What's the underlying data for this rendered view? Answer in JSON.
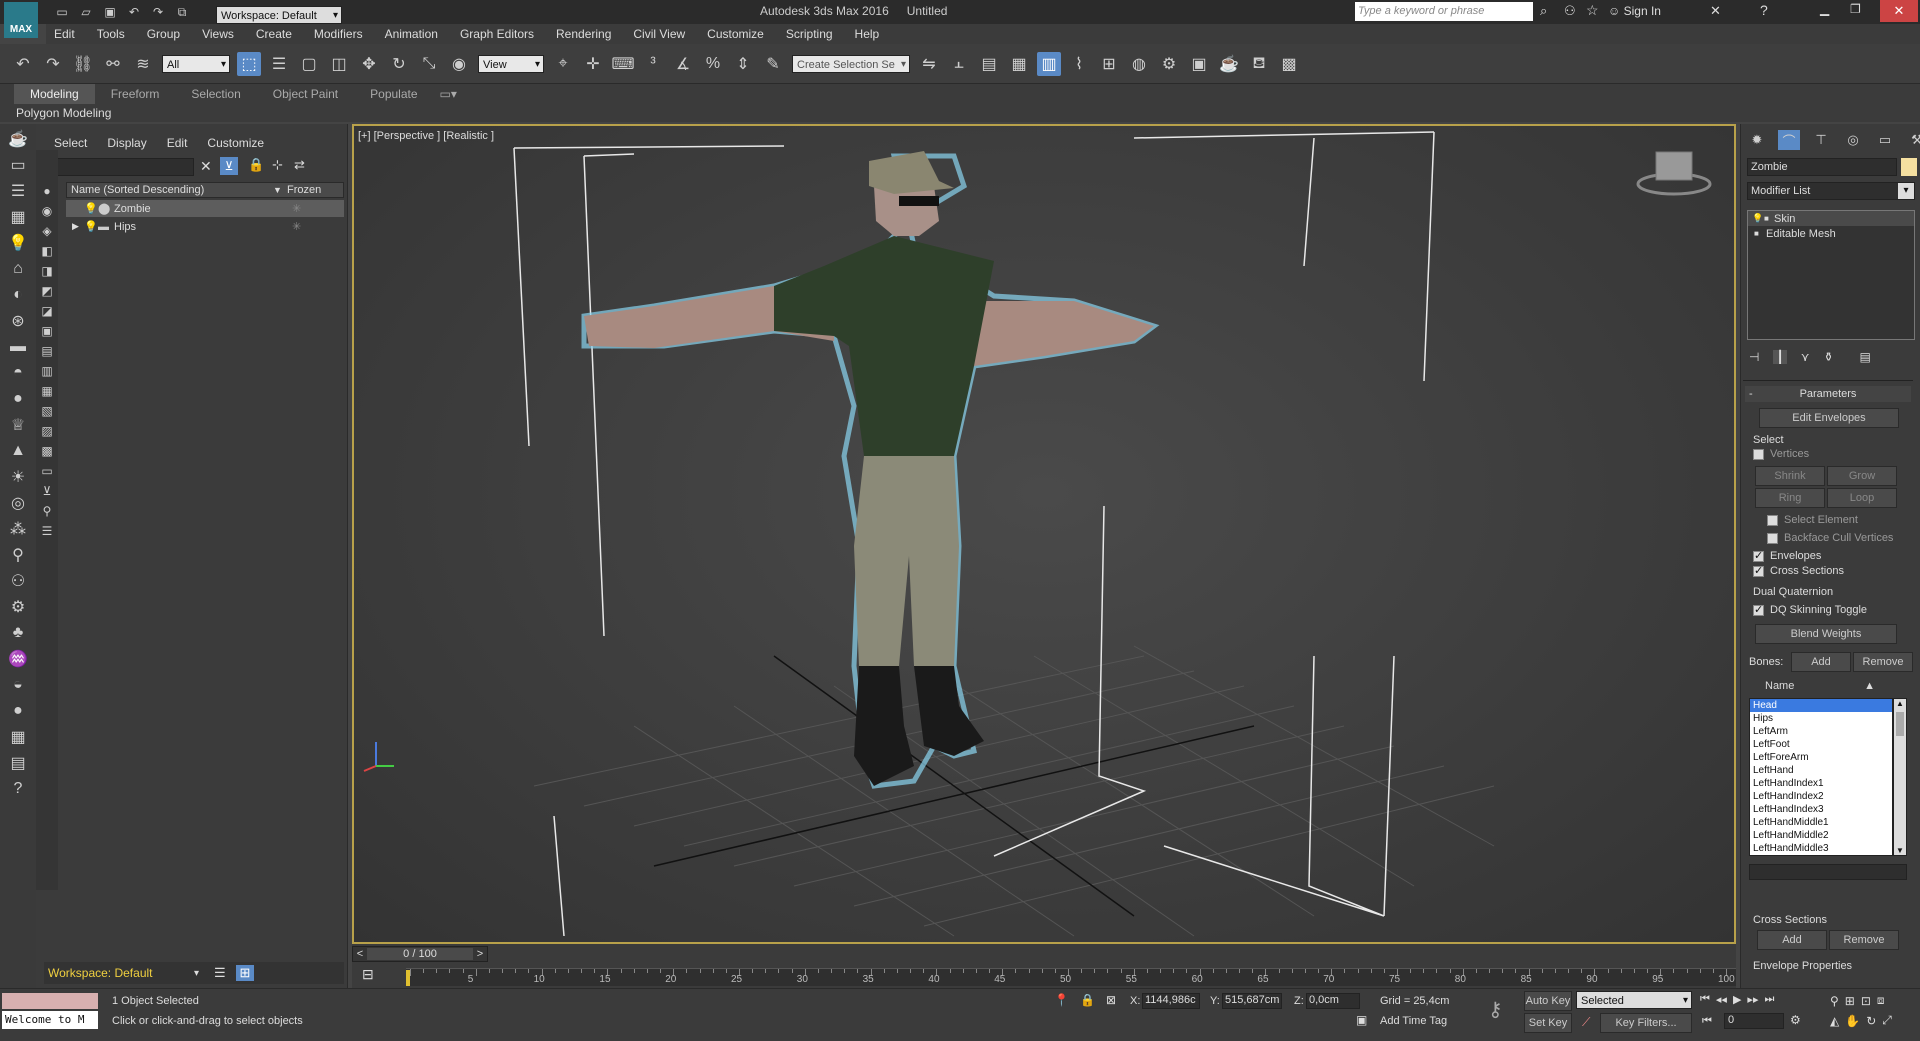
{
  "title_bar": {
    "workspace_label": "Workspace: Default",
    "app_title": "Autodesk 3ds Max 2016",
    "doc_title": "Untitled",
    "search_placeholder": "Type a keyword or phrase",
    "sign_in": "Sign In"
  },
  "menu": [
    "Edit",
    "Tools",
    "Group",
    "Views",
    "Create",
    "Modifiers",
    "Animation",
    "Graph Editors",
    "Rendering",
    "Civil View",
    "Customize",
    "Scripting",
    "Help"
  ],
  "toolbar": {
    "filter_value": "All",
    "refcoord_value": "View",
    "selection_set_placeholder": "Create Selection Se"
  },
  "ribbon_tabs": [
    "Modeling",
    "Freeform",
    "Selection",
    "Object Paint",
    "Populate"
  ],
  "ribbon_sub": "Polygon Modeling",
  "explorer": {
    "menus": [
      "Select",
      "Display",
      "Edit",
      "Customize"
    ],
    "col_name": "Name (Sorted Descending)",
    "col_frozen": "Frozen",
    "items": [
      {
        "name": "Zombie",
        "selected": true
      },
      {
        "name": "Hips",
        "selected": false
      }
    ],
    "workspace": "Workspace: Default"
  },
  "viewport": {
    "label": "[+] [Perspective ] [Realistic ]"
  },
  "timeline": {
    "frame": "0 / 100",
    "ticks": [
      "5",
      "10",
      "15",
      "20",
      "25",
      "30",
      "35",
      "40",
      "45",
      "50",
      "55",
      "60",
      "65",
      "70",
      "75",
      "80",
      "85",
      "90",
      "95",
      "100"
    ]
  },
  "cmd_panel": {
    "object_name": "Zombie",
    "modifier_list": "Modifier List",
    "stack": [
      "Skin",
      "Editable Mesh"
    ],
    "parameters": "Parameters",
    "edit_envelopes": "Edit Envelopes",
    "select_group": "Select",
    "vertices": "Vertices",
    "shrink": "Shrink",
    "grow": "Grow",
    "ring": "Ring",
    "loop": "Loop",
    "select_element": "Select Element",
    "backface_cull": "Backface Cull Vertices",
    "envelopes": "Envelopes",
    "cross_sections": "Cross Sections",
    "dual_quaternion": "Dual Quaternion",
    "dq_toggle": "DQ Skinning Toggle",
    "blend_weights": "Blend Weights",
    "bones_label": "Bones:",
    "add": "Add",
    "remove": "Remove",
    "name_col": "Name",
    "bones": [
      "Head",
      "Hips",
      "LeftArm",
      "LeftFoot",
      "LeftForeArm",
      "LeftHand",
      "LeftHandIndex1",
      "LeftHandIndex2",
      "LeftHandIndex3",
      "LeftHandMiddle1",
      "LeftHandMiddle2",
      "LeftHandMiddle3"
    ],
    "cross_sections_group": "Cross Sections",
    "cs_add": "Add",
    "cs_remove": "Remove",
    "envelope_props": "Envelope Properties"
  },
  "status": {
    "maxscript": "Welcome to M",
    "selected": "1 Object Selected",
    "prompt": "Click or click-and-drag to select objects",
    "x_label": "X:",
    "x": "1144,986c",
    "y_label": "Y:",
    "y": "515,687cm",
    "z_label": "Z:",
    "z": "0,0cm",
    "grid": "Grid = 25,4cm",
    "add_time_tag": "Add Time Tag",
    "auto_key": "Auto Key",
    "auto_key_sel": "Selected",
    "set_key": "Set Key",
    "key_filters": "Key Filters...",
    "frame_field": "0"
  }
}
